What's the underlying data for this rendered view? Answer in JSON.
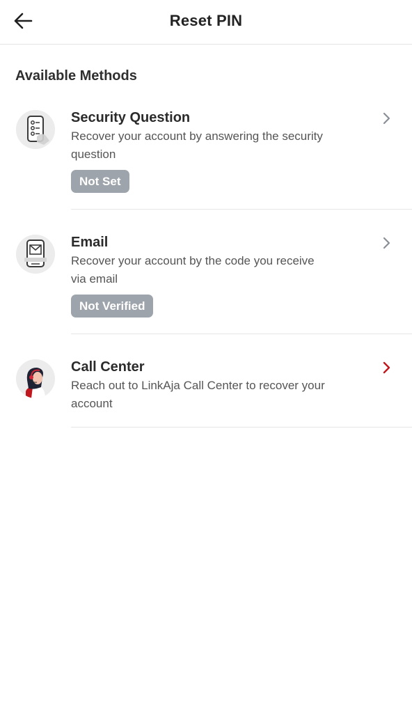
{
  "header": {
    "title": "Reset PIN",
    "back_icon": "arrow-left-icon"
  },
  "section": {
    "title": "Available Methods"
  },
  "methods": [
    {
      "icon": "phone-security-question-icon",
      "title": "Security Question",
      "description": "Recover your account by answering the security question",
      "badge": "Not Set",
      "chevron_color": "#8a8f96"
    },
    {
      "icon": "phone-email-icon",
      "title": "Email",
      "description": "Recover your account by the code you receive via email",
      "badge": "Not Verified",
      "chevron_color": "#8a8f96"
    },
    {
      "icon": "call-center-agent-icon",
      "title": "Call Center",
      "description": "Reach out to LinkAja Call Center to recover your account",
      "chevron_color": "#c0161d"
    }
  ],
  "colors": {
    "badge_bg": "#9ea4ab",
    "accent_red": "#c0161d",
    "divider": "#e6e6e6"
  }
}
